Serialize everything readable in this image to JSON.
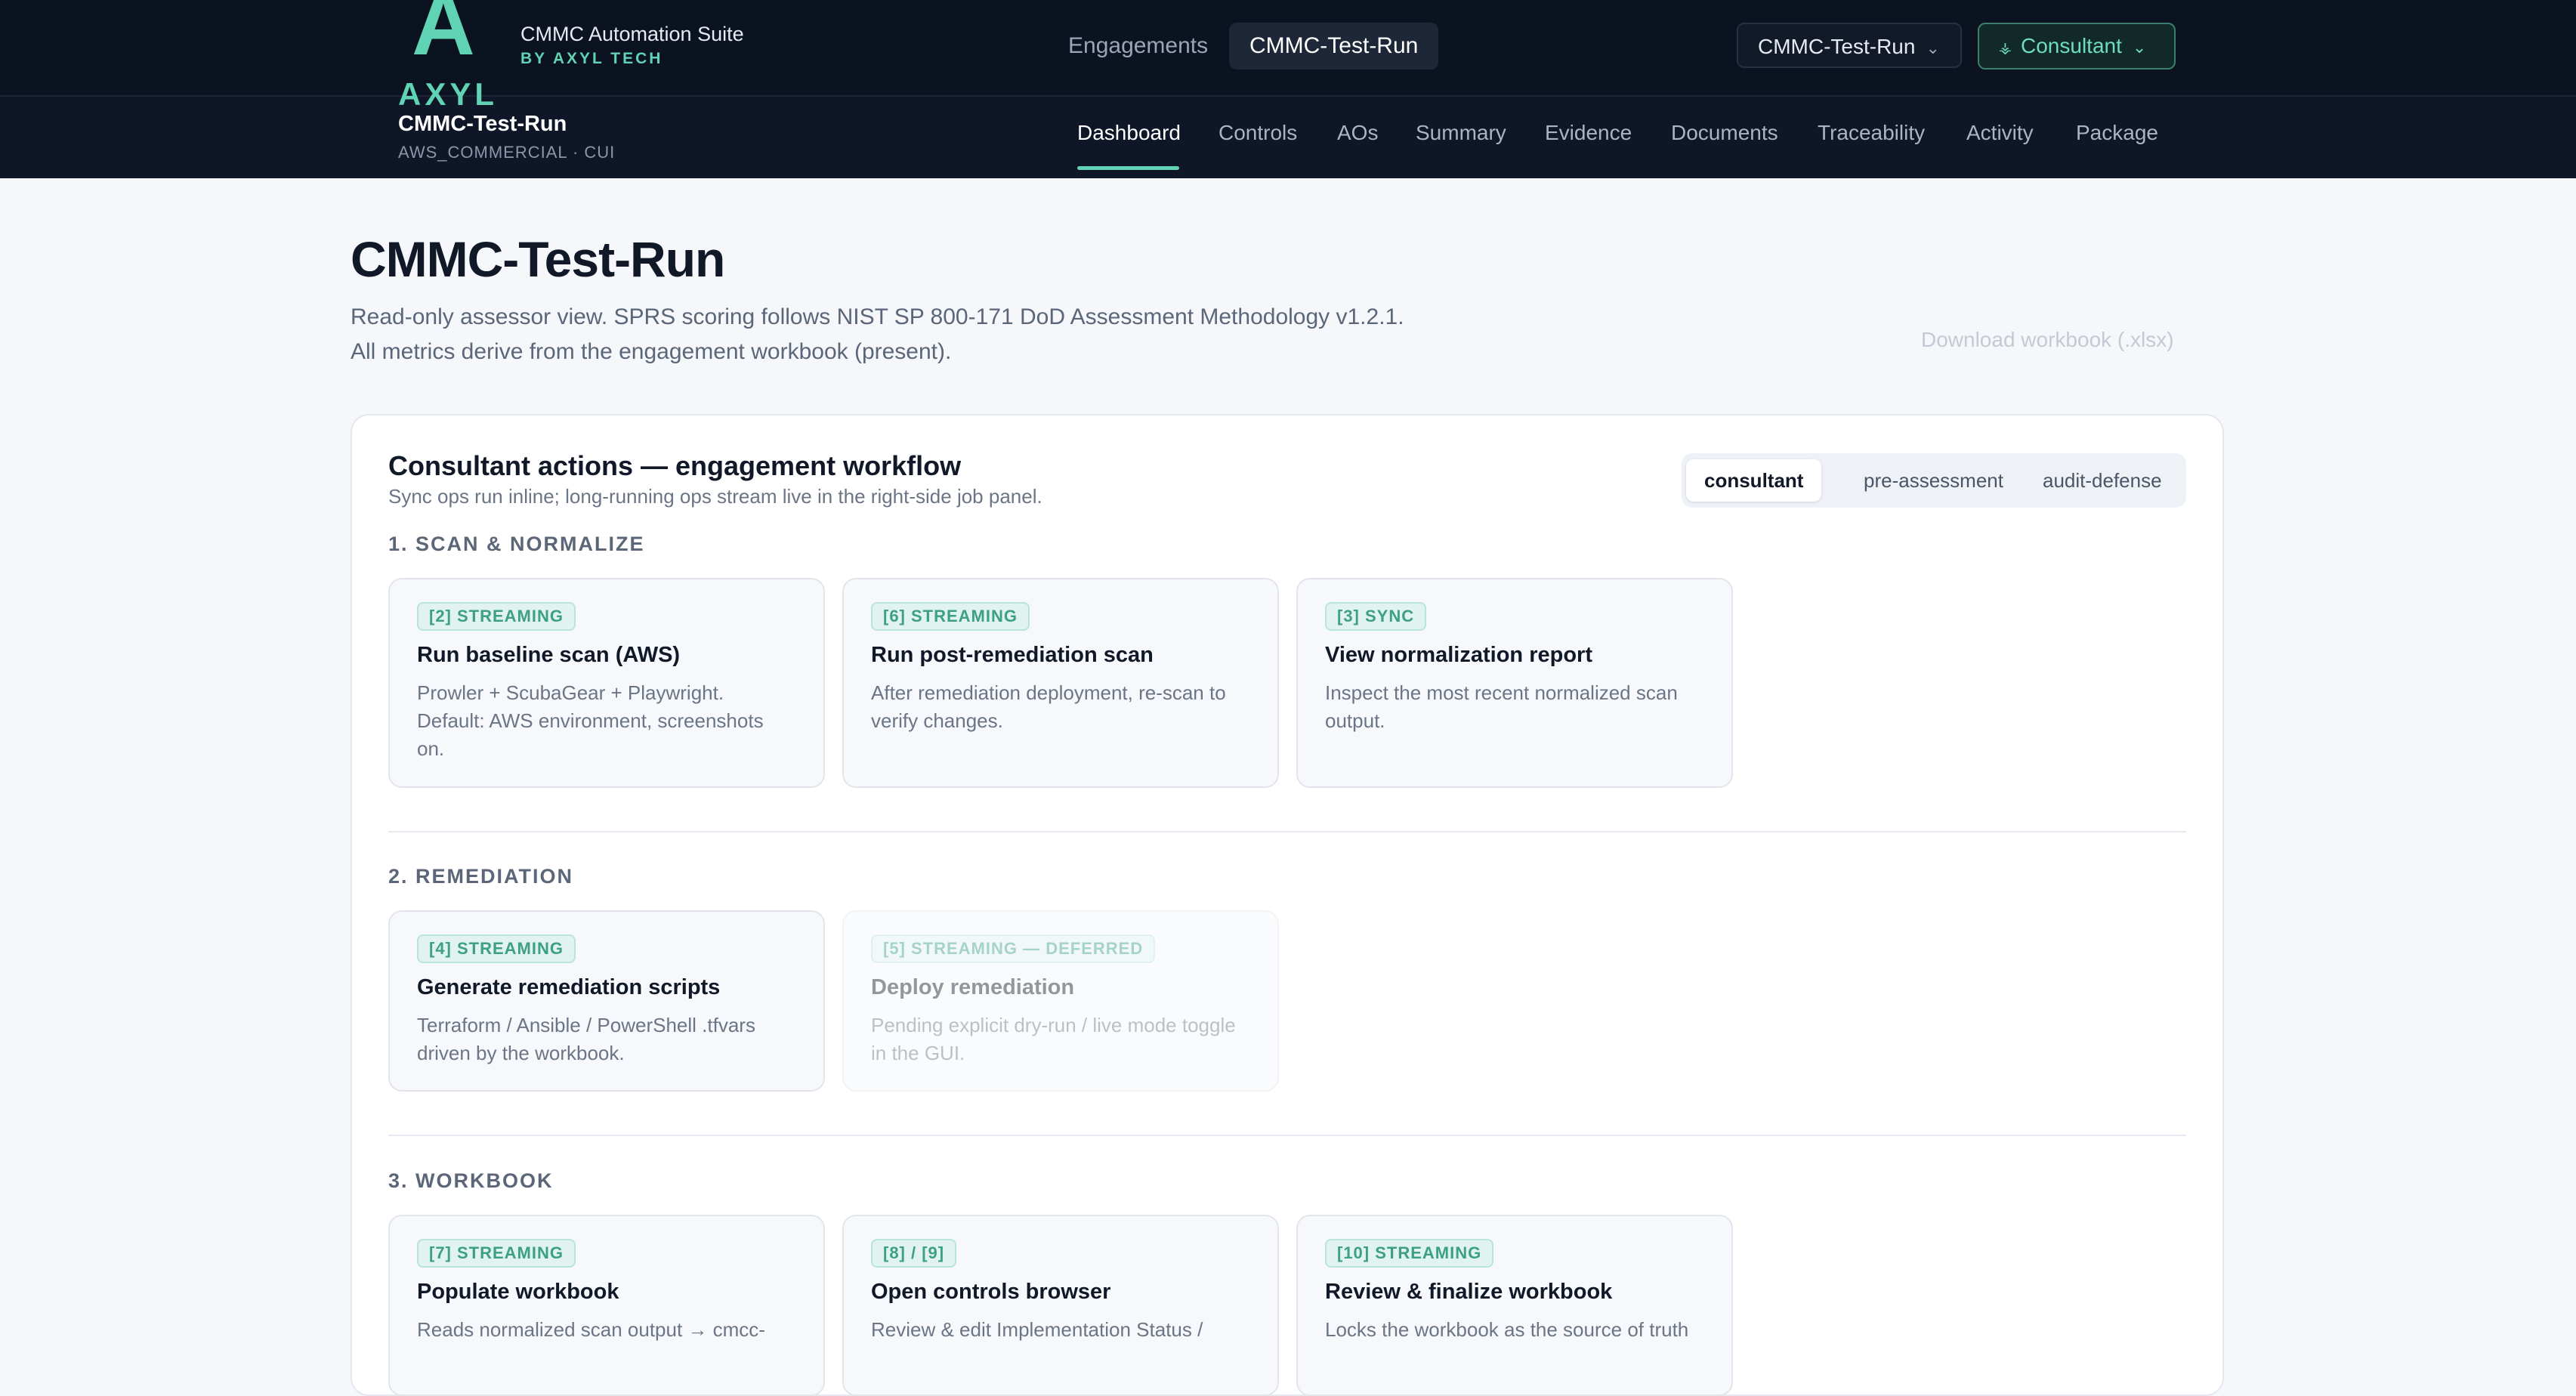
{
  "brand": {
    "logo_letter": "A",
    "logo_word": "AXYL",
    "title": "CMMC Automation Suite",
    "subtitle": "BY AXYL TECH"
  },
  "top_nav": [
    {
      "label": "Engagements"
    },
    {
      "label": "CMMC-Test-Run",
      "active": true
    }
  ],
  "project_select": {
    "value": "CMMC-Test-Run",
    "icon": "chevron-down-icon"
  },
  "role_select": {
    "value": "Consultant",
    "icon": "lock-icon"
  },
  "engagement": {
    "name": "CMMC-Test-Run",
    "env": "AWS_COMMERCIAL · CUI"
  },
  "sub_nav": [
    {
      "label": "Dashboard",
      "active": true
    },
    {
      "label": "Controls"
    },
    {
      "label": "AOs"
    },
    {
      "label": "Summary"
    },
    {
      "label": "Evidence"
    },
    {
      "label": "Documents"
    },
    {
      "label": "Traceability"
    },
    {
      "label": "Activity"
    },
    {
      "label": "Package"
    }
  ],
  "page": {
    "title": "CMMC-Test-Run",
    "intro_line1": "Read-only assessor view. SPRS scoring follows NIST SP 800-171 DoD Assessment Methodology v1.2.1.",
    "intro_line2": "All metrics derive from the engagement workbook (present).",
    "download_label": "Download workbook (.xlsx)"
  },
  "actions": {
    "title": "Consultant actions — engagement workflow",
    "subtitle": "Sync ops run inline; long-running ops stream live in the right-side job panel.",
    "tabs": [
      {
        "label": "consultant",
        "active": true
      },
      {
        "label": "pre-assessment"
      },
      {
        "label": "audit-defense"
      }
    ],
    "sections": [
      {
        "label": "1. SCAN & NORMALIZE",
        "tiles": [
          {
            "badge": "[2] STREAMING",
            "title": "Run baseline scan (AWS)",
            "desc": "Prowler + ScubaGear + Playwright. Default: AWS environment, screenshots on."
          },
          {
            "badge": "[6] STREAMING",
            "title": "Run post-remediation scan",
            "desc": "After remediation deployment, re-scan to verify changes."
          },
          {
            "badge": "[3] SYNC",
            "title": "View normalization report",
            "desc": "Inspect the most recent normalized scan output."
          }
        ]
      },
      {
        "label": "2. REMEDIATION",
        "tiles": [
          {
            "badge": "[4] STREAMING",
            "title": "Generate remediation scripts",
            "desc": "Terraform / Ansible / PowerShell .tfvars driven by the workbook."
          },
          {
            "badge": "[5] STREAMING — DEFERRED",
            "title": "Deploy remediation",
            "desc": "Pending explicit dry-run / live mode toggle in the GUI.",
            "deferred": true
          }
        ]
      },
      {
        "label": "3. WORKBOOK",
        "tiles": [
          {
            "badge": "[7] STREAMING",
            "title": "Populate workbook",
            "desc": "Reads normalized scan output → cmcc-"
          },
          {
            "badge": "[8] / [9]",
            "title": "Open controls browser",
            "desc": "Review & edit Implementation Status /"
          },
          {
            "badge": "[10] STREAMING",
            "title": "Review & finalize workbook",
            "desc": "Locks the workbook as the source of truth"
          }
        ]
      }
    ]
  }
}
